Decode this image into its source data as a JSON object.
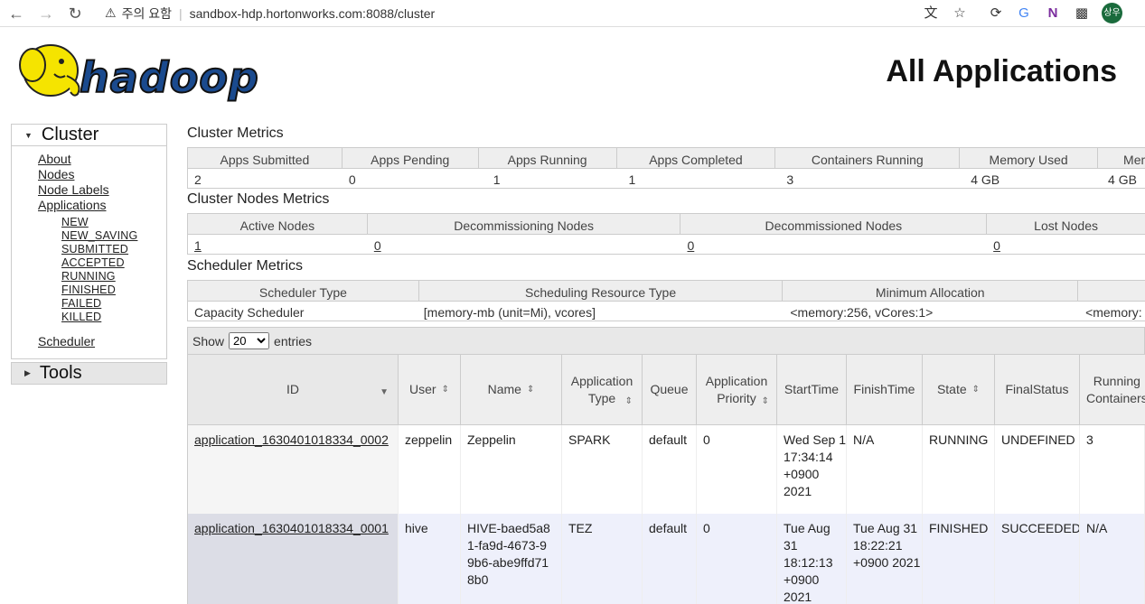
{
  "browser": {
    "warning_label": "주의 요함",
    "url": "sandbox-hdp.hortonworks.com:8088/cluster",
    "avatar_text": "상우"
  },
  "header": {
    "logo_text": "hadoop",
    "title": "All Applications"
  },
  "sidebar": {
    "cluster_label": "Cluster",
    "links": [
      "About",
      "Nodes",
      "Node Labels",
      "Applications"
    ],
    "app_states": [
      "NEW",
      "NEW_SAVING",
      "SUBMITTED",
      "ACCEPTED",
      "RUNNING",
      "FINISHED",
      "FAILED",
      "KILLED"
    ],
    "scheduler_label": "Scheduler",
    "tools_label": "Tools"
  },
  "cluster_metrics": {
    "title": "Cluster Metrics",
    "headers": [
      "Apps Submitted",
      "Apps Pending",
      "Apps Running",
      "Apps Completed",
      "Containers Running",
      "Memory Used",
      "Mem"
    ],
    "values": [
      "2",
      "0",
      "1",
      "1",
      "3",
      "4 GB",
      "4 GB"
    ]
  },
  "node_metrics": {
    "title": "Cluster Nodes Metrics",
    "headers": [
      "Active Nodes",
      "Decommissioning Nodes",
      "Decommissioned Nodes",
      "Lost Nodes"
    ],
    "values": [
      "1",
      "0",
      "0",
      "0"
    ]
  },
  "scheduler_metrics": {
    "title": "Scheduler Metrics",
    "headers": [
      "Scheduler Type",
      "Scheduling Resource Type",
      "Minimum Allocation",
      ""
    ],
    "values": [
      "Capacity Scheduler",
      "[memory-mb (unit=Mi), vcores]",
      "<memory:256, vCores:1>",
      "<memory:"
    ]
  },
  "entries": {
    "show_label": "Show",
    "page_size": "20",
    "entries_label": "entries"
  },
  "apps_table": {
    "headers": [
      "ID",
      "User",
      "Name",
      "Application Type",
      "Queue",
      "Application Priority",
      "StartTime",
      "FinishTime",
      "State",
      "FinalStatus",
      "Running Containers"
    ],
    "rows": [
      {
        "id": "application_1630401018334_0002",
        "user": "zeppelin",
        "name": "Zeppelin",
        "type": "SPARK",
        "queue": "default",
        "priority": "0",
        "start": "Wed Sep 1 17:34:14 +0900 2021",
        "finish": "N/A",
        "state": "RUNNING",
        "final_status": "UNDEFINED",
        "running_containers": "3"
      },
      {
        "id": "application_1630401018334_0001",
        "user": "hive",
        "name": "HIVE-baed5a81-fa9d-4673-99b6-abe9ffd718b0",
        "type": "TEZ",
        "queue": "default",
        "priority": "0",
        "start": "Tue Aug 31 18:12:13 +0900 2021",
        "finish": "Tue Aug 31 18:22:21 +0900 2021",
        "state": "FINISHED",
        "final_status": "SUCCEEDED",
        "running_containers": "N/A"
      }
    ]
  }
}
